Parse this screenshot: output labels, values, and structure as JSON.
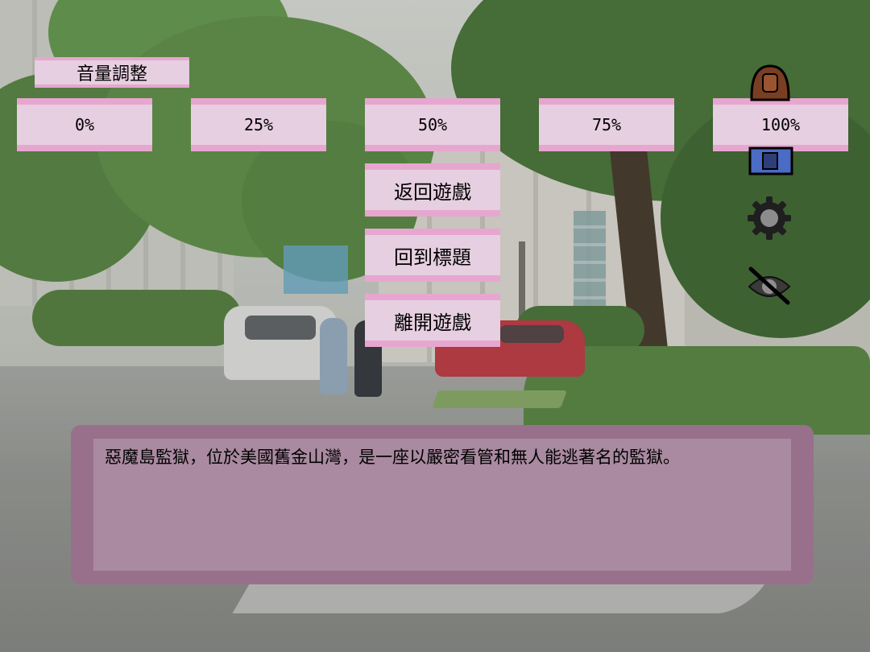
{
  "volume": {
    "title": "音量調整",
    "options": [
      "0%",
      "25%",
      "50%",
      "75%",
      "100%"
    ]
  },
  "menu": {
    "resume_label": "返回遊戲",
    "title_label": "回到標題",
    "exit_label": "離開遊戲"
  },
  "side_icons": [
    "backpack-icon",
    "gear-icon",
    "hide-eye-icon"
  ],
  "dialog": {
    "text": "惡魔島監獄，位於美國舊金山灣，是一座以嚴密看管和無人能逃著名的監獄。"
  },
  "colors": {
    "button_fill": "#e6cfe0",
    "button_border": "#e7a6cf",
    "dialog_frame": "#99708c",
    "dialog_inner": "#a98aa0"
  }
}
